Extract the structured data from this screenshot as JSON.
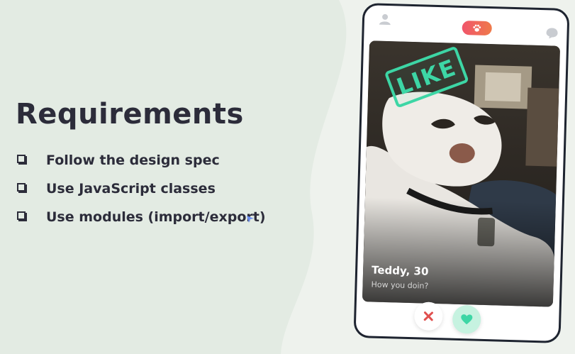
{
  "slide": {
    "title": "Requirements",
    "requirements": [
      "Follow the design spec",
      "Use JavaScript classes",
      "Use modules (import/export)"
    ]
  },
  "phone": {
    "card": {
      "stamp": "LIKE",
      "name": "Teddy, 30",
      "bio": "How you doin?"
    },
    "icons": {
      "profile": "user-icon",
      "logo": "paw-icon",
      "chat": "chat-bubble-icon",
      "nope": "close-icon",
      "like": "heart-icon"
    }
  },
  "colors": {
    "background": "#e3ebe3",
    "text": "#2c2c3a",
    "like_accent": "#3dd6a5",
    "nope_accent": "#e0504f",
    "logo_gradient": [
      "#f0556b",
      "#ef7a4a"
    ]
  }
}
